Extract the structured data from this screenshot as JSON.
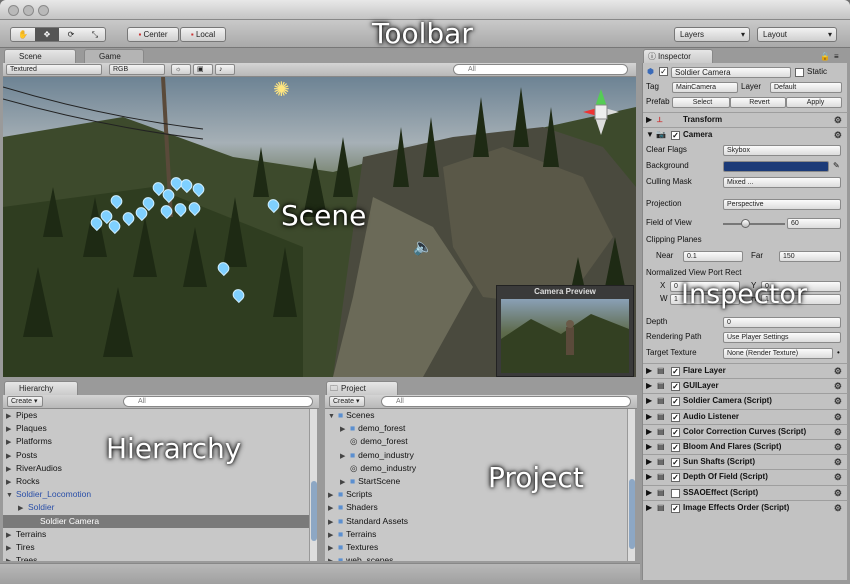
{
  "window": {
    "toolbar_label": "Toolbar",
    "scene_label": "Scene",
    "inspector_label": "Inspector",
    "hierarchy_label": "Hierarchy",
    "project_label": "Project"
  },
  "toolbar": {
    "center": "Center",
    "local": "Local",
    "layers": "Layers",
    "layout": "Layout"
  },
  "scene_tabs": {
    "scene": "Scene",
    "game": "Game",
    "render_mode": "Textured",
    "color_mode": "RGB",
    "search": "All"
  },
  "camera_preview_title": "Camera Preview",
  "hierarchy": {
    "tab": "Hierarchy",
    "create": "Create",
    "search": "All",
    "items": [
      {
        "label": "Pipes",
        "indent": 0,
        "arrow": "▶"
      },
      {
        "label": "Plaques",
        "indent": 0,
        "arrow": "▶"
      },
      {
        "label": "Platforms",
        "indent": 0,
        "arrow": "▶"
      },
      {
        "label": "Posts",
        "indent": 0,
        "arrow": "▶"
      },
      {
        "label": "RiverAudios",
        "indent": 0,
        "arrow": "▶"
      },
      {
        "label": "Rocks",
        "indent": 0,
        "arrow": "▶"
      },
      {
        "label": "Soldier_Locomotion",
        "indent": 0,
        "arrow": "▼",
        "color": "#2a4fa8"
      },
      {
        "label": "Soldier",
        "indent": 1,
        "arrow": "▶",
        "color": "#2a4fa8"
      },
      {
        "label": "Soldier Camera",
        "indent": 2,
        "arrow": "",
        "color": "#ffffff",
        "selected": true
      },
      {
        "label": "Terrains",
        "indent": 0,
        "arrow": "▶"
      },
      {
        "label": "Tires",
        "indent": 0,
        "arrow": "▶"
      },
      {
        "label": "Trees",
        "indent": 0,
        "arrow": "▶"
      }
    ]
  },
  "project": {
    "tab": "Project",
    "create": "Create",
    "search": "All",
    "items": [
      {
        "label": "Scenes",
        "indent": 0,
        "arrow": "▼",
        "icon": "folder"
      },
      {
        "label": "demo_forest",
        "indent": 1,
        "arrow": "▶",
        "icon": "folder"
      },
      {
        "label": "demo_forest",
        "indent": 1,
        "arrow": "",
        "icon": "scene"
      },
      {
        "label": "demo_industry",
        "indent": 1,
        "arrow": "▶",
        "icon": "folder"
      },
      {
        "label": "demo_industry",
        "indent": 1,
        "arrow": "",
        "icon": "scene"
      },
      {
        "label": "StartScene",
        "indent": 1,
        "arrow": "▶",
        "icon": "folder"
      },
      {
        "label": "Scripts",
        "indent": 0,
        "arrow": "▶",
        "icon": "folder"
      },
      {
        "label": "Shaders",
        "indent": 0,
        "arrow": "▶",
        "icon": "folder"
      },
      {
        "label": "Standard Assets",
        "indent": 0,
        "arrow": "▶",
        "icon": "folder"
      },
      {
        "label": "Terrains",
        "indent": 0,
        "arrow": "▶",
        "icon": "folder"
      },
      {
        "label": "Textures",
        "indent": 0,
        "arrow": "▶",
        "icon": "folder"
      },
      {
        "label": "web_scenes",
        "indent": 0,
        "arrow": "▶",
        "icon": "folder"
      }
    ]
  },
  "inspector": {
    "tab": "Inspector",
    "object_name": "Soldier Camera",
    "static": "Static",
    "tag_label": "Tag",
    "tag_value": "MainCamera",
    "layer_label": "Layer",
    "layer_value": "Default",
    "prefab_label": "Prefab",
    "select": "Select",
    "revert": "Revert",
    "apply": "Apply",
    "transform": "Transform",
    "camera": "Camera",
    "clear_flags": "Clear Flags",
    "clear_flags_value": "Skybox",
    "background": "Background",
    "background_color": "#1b3a78",
    "culling_mask": "Culling Mask",
    "culling_mask_value": "Mixed ...",
    "projection": "Projection",
    "projection_value": "Perspective",
    "fov": "Field of View",
    "fov_value": "60",
    "fov_level": 0.35,
    "clipping": "Clipping Planes",
    "near": "Near",
    "near_value": "0.1",
    "far": "Far",
    "far_value": "150",
    "viewport": "Normalized View Port Rect",
    "x": "X",
    "x_value": "0",
    "y": "Y",
    "y_value": "0",
    "w": "W",
    "w_value": "1",
    "h": "H",
    "h_value": "1",
    "depth": "Depth",
    "depth_value": "0",
    "rendering_path": "Rendering Path",
    "rendering_path_value": "Use Player Settings",
    "target_texture": "Target Texture",
    "target_texture_value": "None (Render Texture)",
    "components": [
      {
        "label": "Flare Layer",
        "checked": true
      },
      {
        "label": "GUILayer",
        "checked": true
      },
      {
        "label": "Soldier Camera (Script)",
        "checked": true
      },
      {
        "label": "Audio Listener",
        "checked": true
      },
      {
        "label": "Color Correction Curves (Script)",
        "checked": true
      },
      {
        "label": "Bloom And Flares (Script)",
        "checked": true
      },
      {
        "label": "Sun Shafts (Script)",
        "checked": true
      },
      {
        "label": "Depth Of Field (Script)",
        "checked": true
      },
      {
        "label": "SSAOEffect (Script)",
        "checked": false
      },
      {
        "label": "Image Effects Order (Script)",
        "checked": true
      }
    ]
  }
}
